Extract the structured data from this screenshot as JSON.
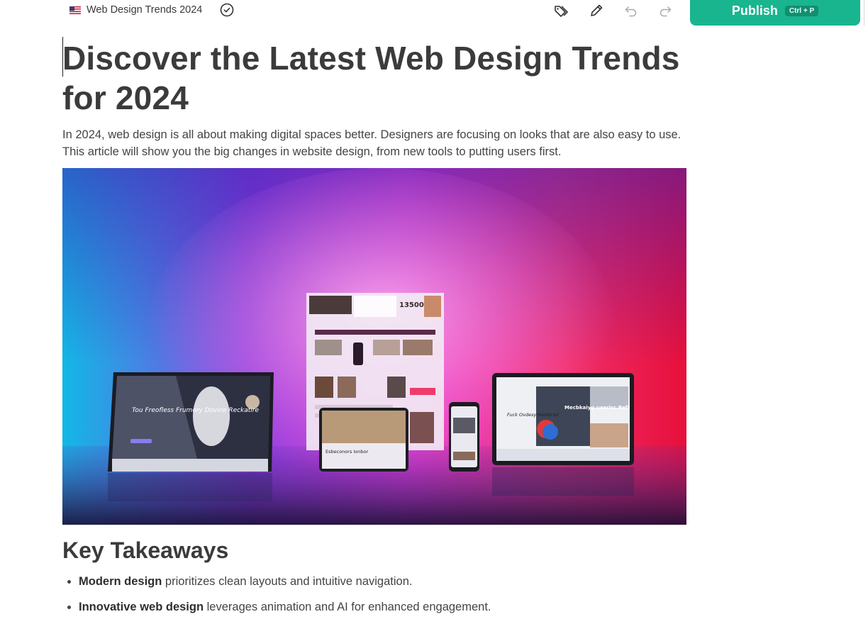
{
  "header": {
    "doc_title": "Web Design Trends 2024",
    "publish_label": "Publish",
    "publish_shortcut": "Ctrl + P",
    "icons": [
      "flag-us-icon",
      "check-circle-icon",
      "tags-icon",
      "pencil-icon",
      "undo-icon",
      "redo-icon"
    ]
  },
  "article": {
    "title": "Discover the Latest Web Design Trends for 2024",
    "intro": "In 2024, web design is all about making digital spaces better. Designers are focusing on looks that are also easy to use. This article will show you the big changes in website design, from new tools to putting users first.",
    "hero": {
      "tablet_left_heading": "Tou Freofless Frumory Dovice Reckatire",
      "center_stat": "13500",
      "center_phone_heading": "Esbeconors Ionbor",
      "tablet_right_heading": "Fuck Ovdesy Reoibrod",
      "tablet_right_feature": "Mecbkaiyg uaerisc Beft"
    },
    "section_heading": "Key Takeaways",
    "takeaways": [
      {
        "bold": "Modern design",
        "text": " prioritizes clean layouts and intuitive navigation."
      },
      {
        "bold": "Innovative web design",
        "text": " leverages animation and AI for enhanced engagement."
      }
    ]
  },
  "colors": {
    "accent": "#19b58f",
    "accent_dark": "#128e70",
    "text": "#3b3b3b"
  }
}
